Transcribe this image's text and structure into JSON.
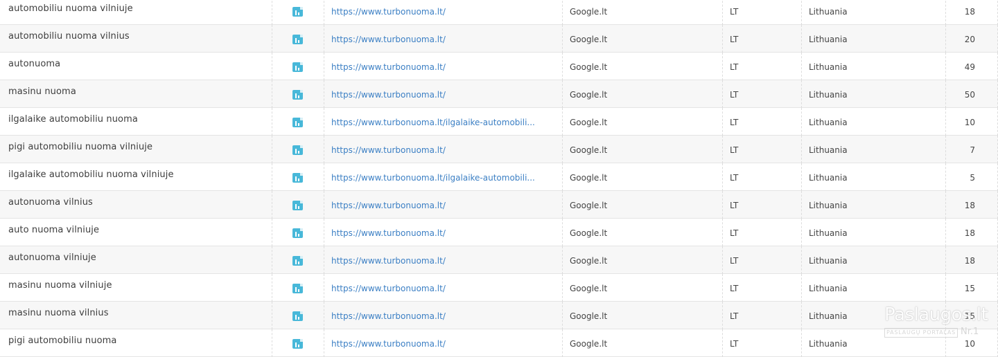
{
  "rows": [
    {
      "keyword": "automobiliu nuoma vilniuje",
      "url": "https://www.turbonuoma.lt/",
      "engine": "Google.lt",
      "country_code": "LT",
      "location": "Lithuania",
      "position": "18"
    },
    {
      "keyword": "automobiliu nuoma vilnius",
      "url": "https://www.turbonuoma.lt/",
      "engine": "Google.lt",
      "country_code": "LT",
      "location": "Lithuania",
      "position": "20"
    },
    {
      "keyword": "autonuoma",
      "url": "https://www.turbonuoma.lt/",
      "engine": "Google.lt",
      "country_code": "LT",
      "location": "Lithuania",
      "position": "49"
    },
    {
      "keyword": "masinu nuoma",
      "url": "https://www.turbonuoma.lt/",
      "engine": "Google.lt",
      "country_code": "LT",
      "location": "Lithuania",
      "position": "50"
    },
    {
      "keyword": "ilgalaike automobiliu nuoma",
      "url": "https://www.turbonuoma.lt/ilgalaike-automobili...",
      "engine": "Google.lt",
      "country_code": "LT",
      "location": "Lithuania",
      "position": "10"
    },
    {
      "keyword": "pigi automobiliu nuoma vilniuje",
      "url": "https://www.turbonuoma.lt/",
      "engine": "Google.lt",
      "country_code": "LT",
      "location": "Lithuania",
      "position": "7"
    },
    {
      "keyword": "ilgalaike automobiliu nuoma vilniuje",
      "url": "https://www.turbonuoma.lt/ilgalaike-automobili...",
      "engine": "Google.lt",
      "country_code": "LT",
      "location": "Lithuania",
      "position": "5"
    },
    {
      "keyword": "autonuoma vilnius",
      "url": "https://www.turbonuoma.lt/",
      "engine": "Google.lt",
      "country_code": "LT",
      "location": "Lithuania",
      "position": "18"
    },
    {
      "keyword": "auto nuoma vilniuje",
      "url": "https://www.turbonuoma.lt/",
      "engine": "Google.lt",
      "country_code": "LT",
      "location": "Lithuania",
      "position": "18"
    },
    {
      "keyword": "autonuoma vilniuje",
      "url": "https://www.turbonuoma.lt/",
      "engine": "Google.lt",
      "country_code": "LT",
      "location": "Lithuania",
      "position": "18"
    },
    {
      "keyword": "masinu nuoma vilniuje",
      "url": "https://www.turbonuoma.lt/",
      "engine": "Google.lt",
      "country_code": "LT",
      "location": "Lithuania",
      "position": "15"
    },
    {
      "keyword": "masinu nuoma vilnius",
      "url": "https://www.turbonuoma.lt/",
      "engine": "Google.lt",
      "country_code": "LT",
      "location": "Lithuania",
      "position": "15"
    },
    {
      "keyword": "pigi automobiliu nuoma",
      "url": "https://www.turbonuoma.lt/",
      "engine": "Google.lt",
      "country_code": "LT",
      "location": "Lithuania",
      "position": "10"
    }
  ],
  "row_icon": "chart-report-icon",
  "colors": {
    "link": "#3b7fc4",
    "icon": "#48b8d9",
    "row_alt": "#f7f7f7",
    "border": "#e4e4e4"
  },
  "watermark": {
    "brand": "Paslaugos.lt",
    "tagline": "PASLAUGŲ PORTALAS",
    "badge": "Nr.1"
  }
}
